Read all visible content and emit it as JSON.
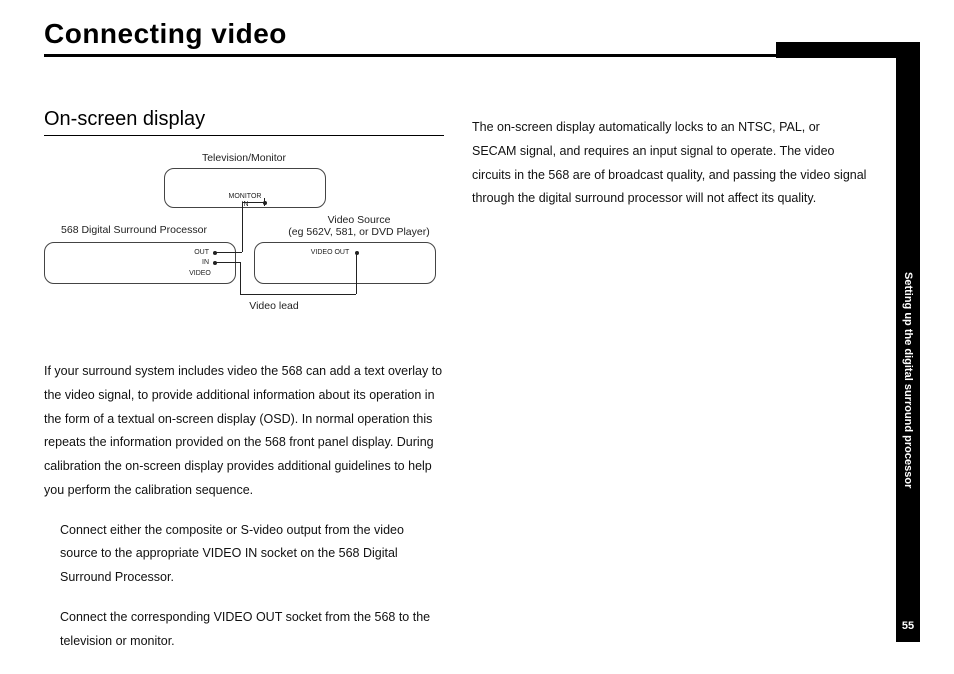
{
  "title": "Connecting video",
  "subhead": "On-screen display",
  "paragraphs": {
    "p1": "If your surround system includes video the 568 can add a text overlay to the video signal, to provide additional information about its operation in the form of a textual on-screen display (OSD). In normal operation this repeats the information provided on the 568 front panel display. During calibration the on-screen display provides additional guidelines to help you perform the calibration sequence.",
    "p2": "Connect either the composite or S-video output from the video source to the appropriate VIDEO IN socket on the 568 Digital Surround Processor.",
    "p3": "Connect the corresponding VIDEO OUT socket from the 568 to the television or monitor.",
    "right": "The on-screen display automatically locks to an NTSC, PAL, or SECAM signal, and requires an input signal to operate. The video circuits in the 568 are of broadcast quality, and passing the video signal through the digital surround processor will not affect its quality."
  },
  "diagram": {
    "tv_label": "Television/Monitor",
    "monitor_in": "MONITOR\nIN",
    "processor_label": "568 Digital Surround Processor",
    "source_label": "Video Source\n(eg 562V, 581, or DVD Player)",
    "out": "OUT",
    "in": "IN",
    "video": "VIDEO",
    "video_out": "VIDEO OUT",
    "video_lead": "Video lead"
  },
  "sidebar": {
    "section": "Setting up the digital surround processor",
    "page": "55"
  }
}
